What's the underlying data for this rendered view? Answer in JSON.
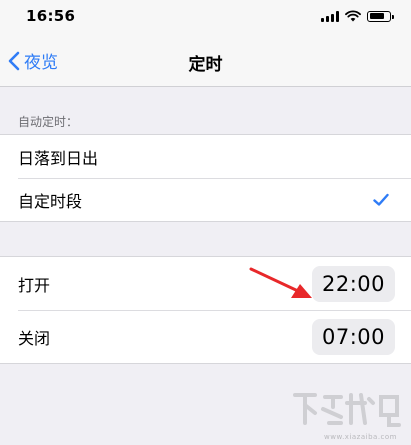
{
  "status_bar": {
    "time": "16:56"
  },
  "nav": {
    "back_label": "夜览",
    "title": "定时"
  },
  "schedule": {
    "header": "自动定时：",
    "options": [
      {
        "label": "日落到日出",
        "selected": false
      },
      {
        "label": "自定时段",
        "selected": true
      }
    ]
  },
  "times": {
    "on_label": "打开",
    "on_value": "22:00",
    "off_label": "关闭",
    "off_value": "07:00"
  },
  "watermark": {
    "url": "www.xiazaiba.com"
  },
  "colors": {
    "accent": "#2f7cf6",
    "annotation_arrow": "#e8282a",
    "background": "#f0eff4"
  }
}
